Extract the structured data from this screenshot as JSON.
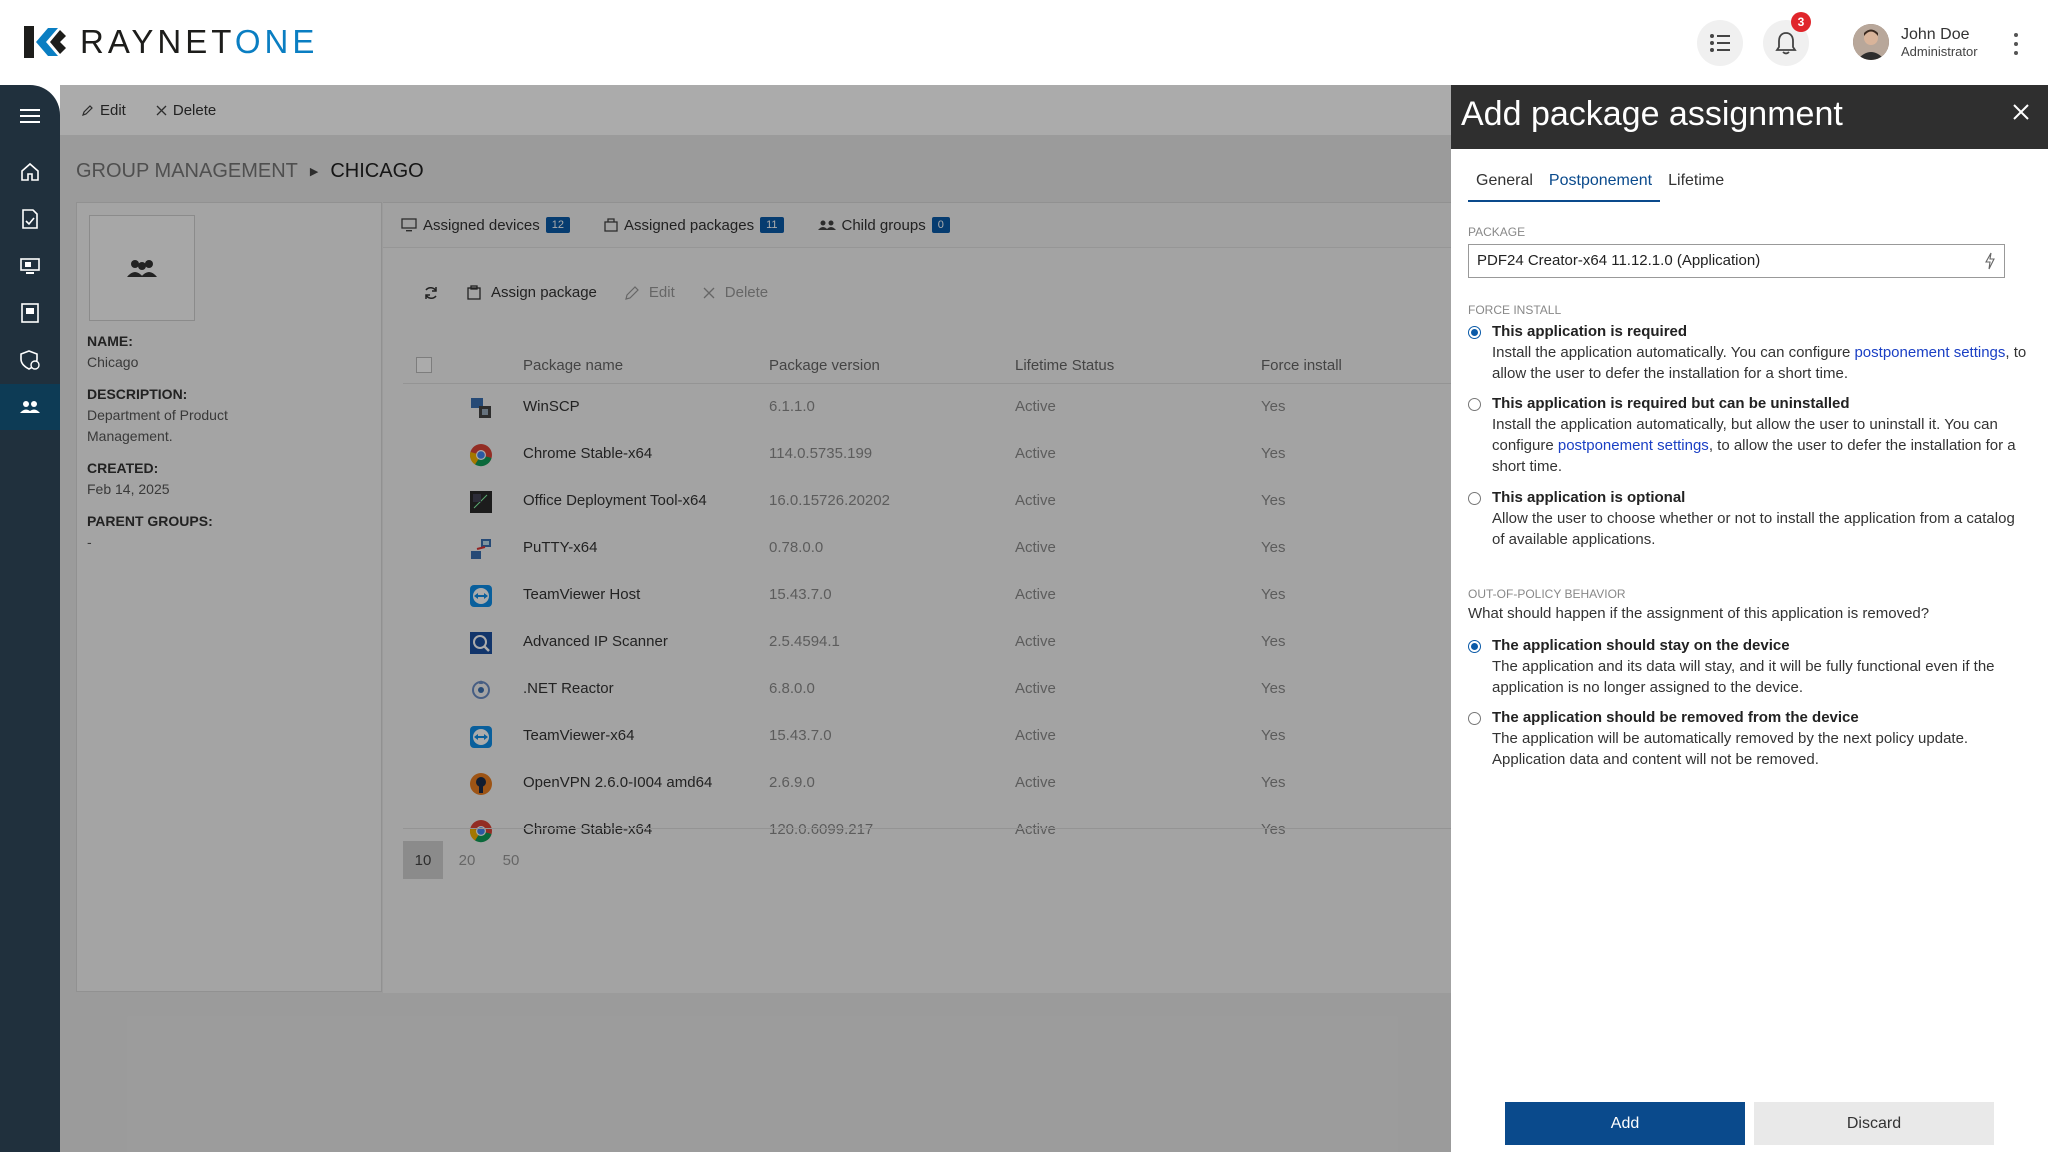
{
  "brand": {
    "name_part1": "RAYNET",
    "name_part2": "ONE"
  },
  "header": {
    "notification_count": "3",
    "user_name": "John Doe",
    "user_role": "Administrator"
  },
  "nav": {
    "icons": [
      "menu-icon",
      "home-icon",
      "document-icon",
      "devices-icon",
      "packages-icon",
      "policy-icon",
      "groups-icon"
    ]
  },
  "toolbar": {
    "edit_label": "Edit",
    "delete_label": "Delete"
  },
  "breadcrumb": {
    "root": "GROUP MANAGEMENT",
    "current": "CHICAGO"
  },
  "group": {
    "name_label": "NAME:",
    "name": "Chicago",
    "description_label": "DESCRIPTION:",
    "description": "Department of Product Management.",
    "created_label": "CREATED:",
    "created": "Feb 14, 2025",
    "parent_label": "PARENT GROUPS:",
    "parent": "-"
  },
  "tabs": [
    {
      "label": "Assigned devices",
      "count": "12"
    },
    {
      "label": "Assigned packages",
      "count": "11"
    },
    {
      "label": "Child groups",
      "count": "0"
    }
  ],
  "table_toolbar": {
    "assign": "Assign package",
    "edit": "Edit",
    "delete": "Delete"
  },
  "table": {
    "headers": [
      "Package name",
      "Package version",
      "Lifetime Status",
      "Force install"
    ],
    "rows": [
      {
        "name": "WinSCP",
        "version": "6.1.1.0",
        "status": "Active",
        "force": "Yes",
        "icon": "winscp-icon"
      },
      {
        "name": "Chrome Stable-x64",
        "version": "114.0.5735.199",
        "status": "Active",
        "force": "Yes",
        "icon": "chrome-icon"
      },
      {
        "name": "Office Deployment Tool-x64",
        "version": "16.0.15726.20202",
        "status": "Active",
        "force": "Yes",
        "icon": "office-tool-icon"
      },
      {
        "name": "PuTTY-x64",
        "version": "0.78.0.0",
        "status": "Active",
        "force": "Yes",
        "icon": "putty-icon"
      },
      {
        "name": "TeamViewer Host",
        "version": "15.43.7.0",
        "status": "Active",
        "force": "Yes",
        "icon": "teamviewer-icon"
      },
      {
        "name": "Advanced IP Scanner",
        "version": "2.5.4594.1",
        "status": "Active",
        "force": "Yes",
        "icon": "ip-scanner-icon"
      },
      {
        "name": ".NET Reactor",
        "version": "6.8.0.0",
        "status": "Active",
        "force": "Yes",
        "icon": "net-reactor-icon"
      },
      {
        "name": "TeamViewer-x64",
        "version": "15.43.7.0",
        "status": "Active",
        "force": "Yes",
        "icon": "teamviewer-icon"
      },
      {
        "name": "OpenVPN 2.6.0-I004 amd64",
        "version": "2.6.9.0",
        "status": "Active",
        "force": "Yes",
        "icon": "openvpn-icon"
      },
      {
        "name": "Chrome Stable-x64",
        "version": "120.0.6099.217",
        "status": "Active",
        "force": "Yes",
        "icon": "chrome-icon"
      }
    ]
  },
  "pager": {
    "sizes": [
      "10",
      "20",
      "50"
    ],
    "selected": "10"
  },
  "panel": {
    "title": "Add package assignment",
    "tabs": [
      "General",
      "Postponement",
      "Lifetime"
    ],
    "package_label": "PACKAGE",
    "package_value": "PDF24 Creator-x64 11.12.1.0 (Application)",
    "force_label": "FORCE INSTALL",
    "opt1_title": "This application is required",
    "opt1_a": "Install the application automatically. You can configure ",
    "opt1_link": "postponement settings",
    "opt1_b": ", to allow the user to defer the installation for a short time.",
    "opt2_title": "This application is required but can be uninstalled",
    "opt2_a": "Install the application automatically, but allow the user to uninstall it. You can configure ",
    "opt2_link": "postponement settings",
    "opt2_b": ", to allow the user to defer the installation for a short time.",
    "opt3_title": "This application is optional",
    "opt3_text": "Allow the user to choose whether or not to install the application from a catalog of available applications.",
    "oop_label": "OUT-OF-POLICY BEHAVIOR",
    "oop_question": "What should happen if the assignment of this application is removed?",
    "opt4_title": "The application should stay on the device",
    "opt4_text": "The application and its data will stay, and it will be fully functional even if the application is no longer assigned to the device.",
    "opt5_title": "The application should be removed from the device",
    "opt5_text": "The application will be automatically removed by the next policy update. Application data and content will not be removed.",
    "add_label": "Add",
    "discard_label": "Discard"
  }
}
